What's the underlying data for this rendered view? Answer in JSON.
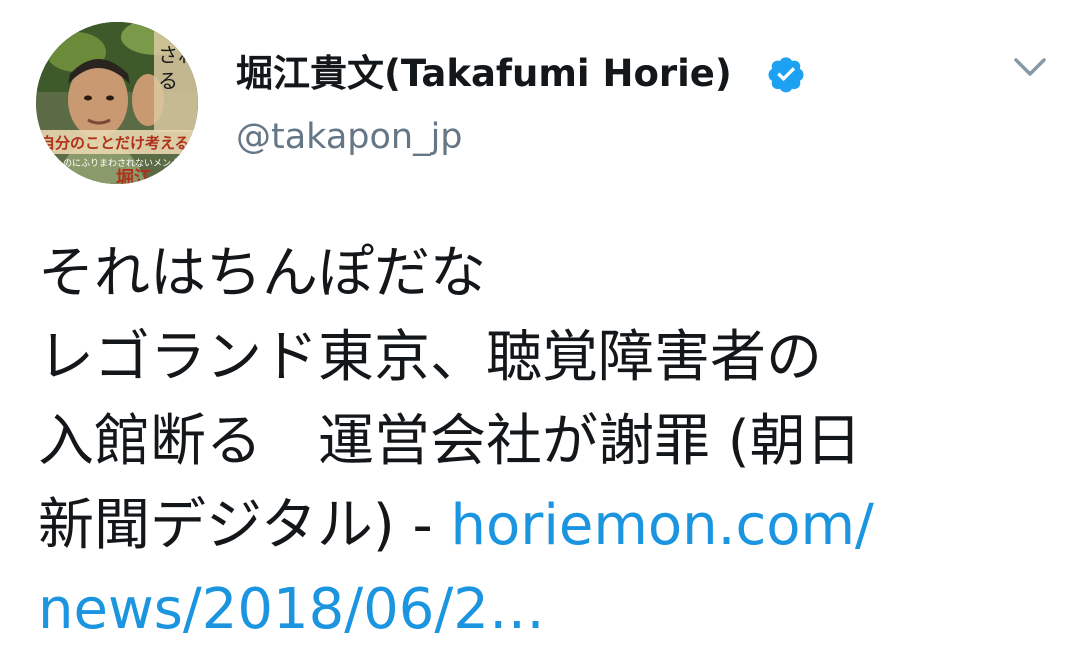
{
  "tweet": {
    "author": {
      "display_name": "堀江貴文(Takafumi Horie)",
      "handle": "@takapon_jp",
      "verified": true,
      "avatar": {
        "icon": "avatar-photo",
        "book_text_1": "されるになれ！",
        "book_text_2": "自分のことだけ考える",
        "book_text_3": "ものにふりまわされないメンタ",
        "book_author": "堀江"
      }
    },
    "menu_icon": "chevron-down-icon",
    "text_lines": [
      "それはちんぽだな",
      "レゴランド東京、聴覚障害者の",
      "入館断る　運営会社が謝罪 (朝日",
      "新聞デジタル) - "
    ],
    "link": {
      "part1": "horiemon.com/",
      "part2": "news/2018/06/2…"
    }
  },
  "colors": {
    "text": "#14171a",
    "secondary_text": "#657786",
    "link": "#1b95e0",
    "verified_badge": "#1da1f2",
    "background": "#ffffff"
  }
}
